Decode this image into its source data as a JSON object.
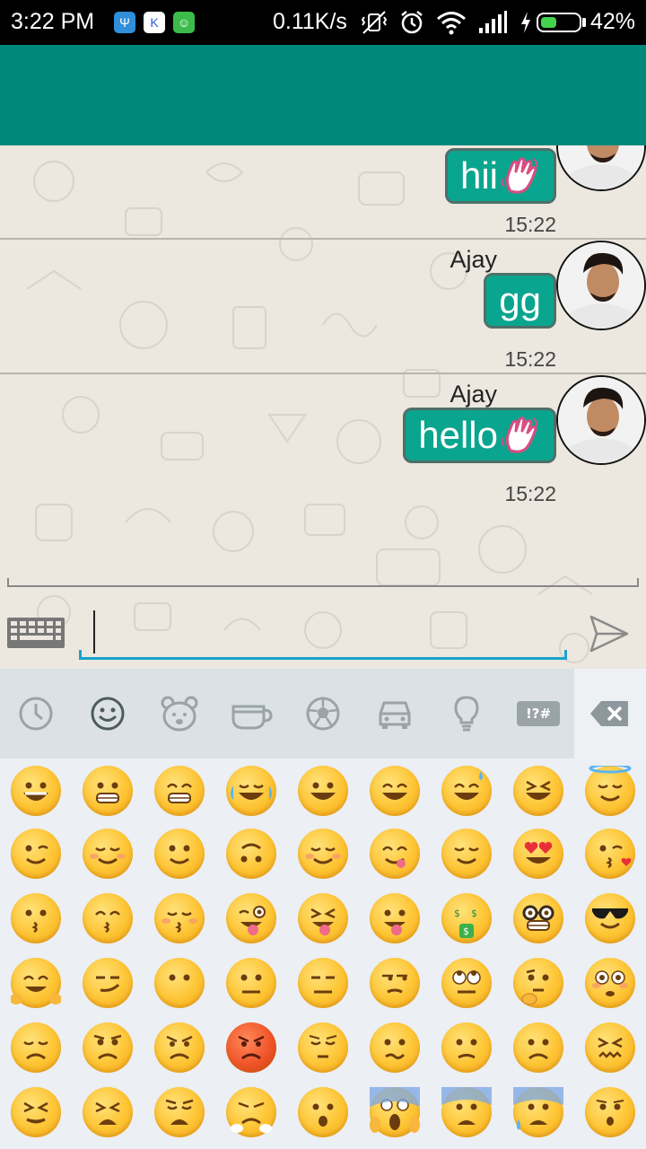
{
  "status_bar": {
    "time": "3:22 PM",
    "speed": "0.11K/s",
    "battery": "42%",
    "battery_level": 0.42,
    "icons": [
      "app-icon-blue",
      "app-icon-white",
      "app-icon-green",
      "mute-vibrate-icon",
      "alarm-icon",
      "wifi-icon",
      "signal-icon",
      "charging-icon",
      "battery-icon"
    ]
  },
  "chat": {
    "messages": [
      {
        "sender": "",
        "text": "hii",
        "emoji": "waving-hand",
        "time": "15:22"
      },
      {
        "sender": "Ajay",
        "text": "gg",
        "emoji": "",
        "time": "15:22"
      },
      {
        "sender": "Ajay",
        "text": "hello",
        "emoji": "waving-hand",
        "time": "15:22"
      }
    ]
  },
  "composer": {
    "value": "",
    "placeholder": "",
    "icons": [
      "keyboard-icon",
      "send-icon"
    ]
  },
  "emoji_panel": {
    "tabs": [
      "recent-icon",
      "smiley-icon",
      "animal-icon",
      "food-icon",
      "sports-icon",
      "travel-icon",
      "objects-icon",
      "symbols-icon",
      "backspace-icon"
    ],
    "selected_tab": "smiley-icon",
    "symbols_tab_label": "!?#",
    "colors": {
      "accent": "#00897b",
      "bubble": "#0aa58e",
      "input_line": "#17a3cc"
    },
    "rows": [
      [
        "grinning",
        "grimacing",
        "grin",
        "joy",
        "smiley",
        "smile",
        "sweat-smile",
        "laughing",
        "innocent"
      ],
      [
        "wink",
        "blush",
        "slight-smile",
        "upside-down",
        "relaxed",
        "yum",
        "relieved",
        "heart-eyes",
        "kissing-heart"
      ],
      [
        "kissing",
        "kissing-smiling-eyes",
        "kissing-closed-eyes",
        "stuck-out-tongue-winking",
        "stuck-out-tongue-closed-eyes",
        "stuck-out-tongue",
        "money-mouth",
        "nerd",
        "sunglasses"
      ],
      [
        "hugging",
        "smirk",
        "no-mouth",
        "neutral",
        "expressionless",
        "unamused",
        "rolling-eyes",
        "thinking",
        "flushed"
      ],
      [
        "disappointed",
        "worried",
        "angry",
        "rage",
        "pensive",
        "confused",
        "slight-frown",
        "frowning",
        "confounded"
      ],
      [
        "persevere",
        "tired",
        "weary",
        "triumph",
        "open-mouth",
        "scream",
        "fearful",
        "cold-sweat",
        "hushed"
      ]
    ]
  }
}
